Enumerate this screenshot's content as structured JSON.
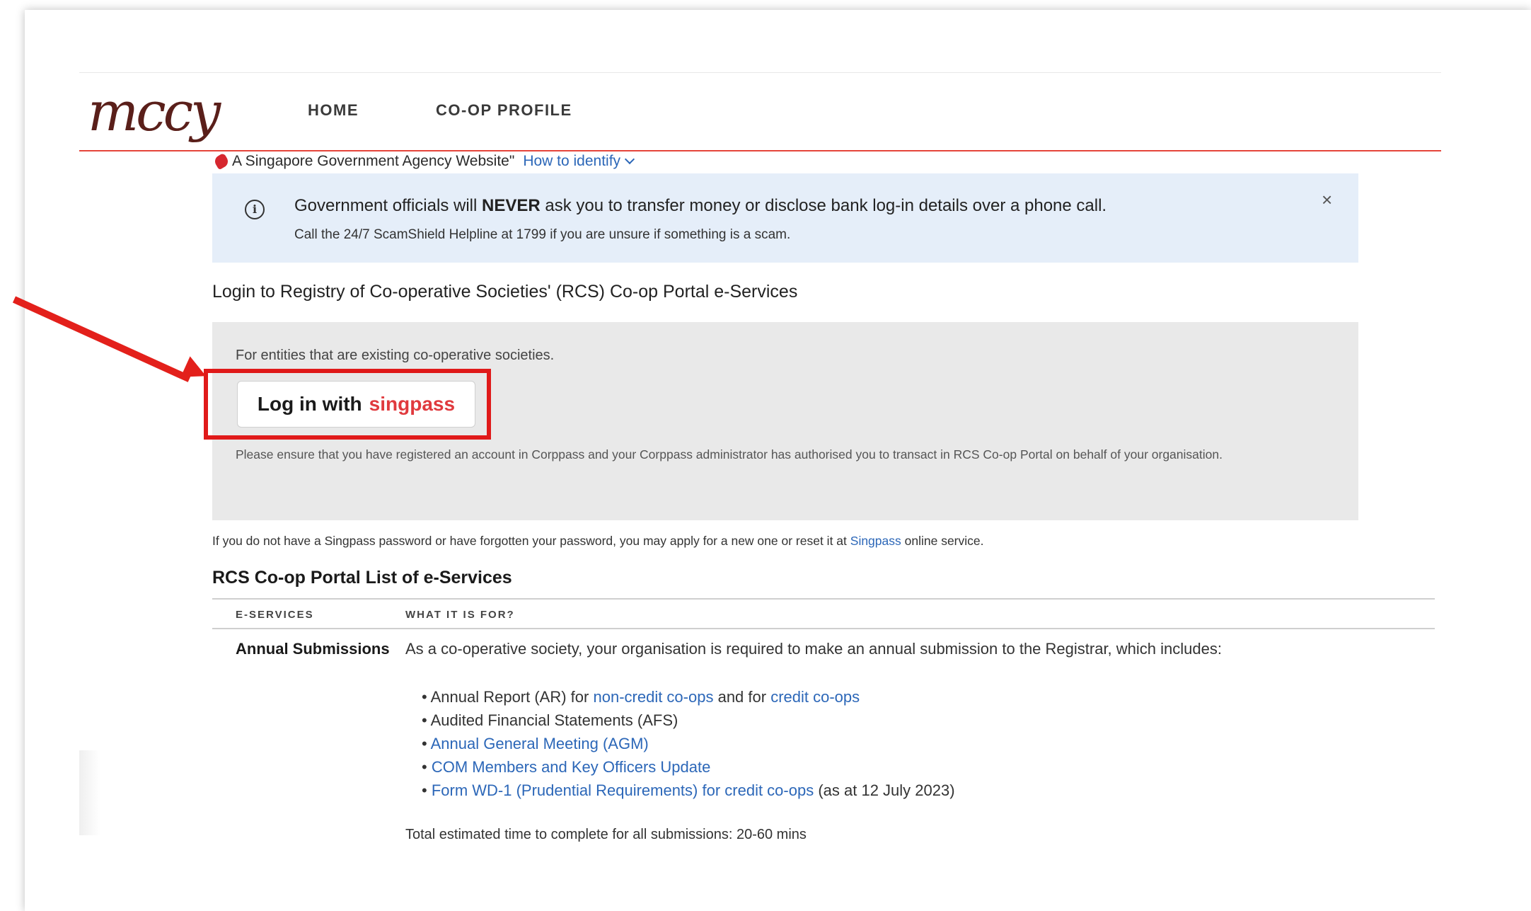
{
  "header": {
    "logo_text": "mccy",
    "nav": [
      "HOME",
      "CO-OP PROFILE"
    ]
  },
  "gov_banner": {
    "text": "A Singapore Government Agency Website\"",
    "identify_link": "How to identify"
  },
  "notice": {
    "line1_pre": "Government officials will ",
    "line1_bold": "NEVER",
    "line1_post": " ask you to transfer money or disclose bank log-in details over a phone call.",
    "line2": "Call the 24/7 ScamShield Helpline at 1799 if you are unsure if something is a scam.",
    "close": "×",
    "info_icon": "i"
  },
  "login": {
    "title": "Login to Registry of Co-operative Societies' (RCS) Co-op Portal e-Services",
    "entity_text": "For entities that are existing co-operative societies.",
    "button_prefix": "Log in with",
    "button_brand": "singpass",
    "ensure_text": "Please ensure that you have registered an account in Corppass and your Corppass administrator has authorised you to transact in RCS Co-op Portal on behalf of your organisation."
  },
  "forgot": {
    "pre": "If you do not have a Singpass password or have forgotten your password, you may apply for a new one or reset it at ",
    "link": "Singpass",
    "post": " online service."
  },
  "eservices": {
    "heading": "RCS Co-op Portal List of e-Services",
    "columns": [
      "E-SERVICES",
      "WHAT IT IS FOR?"
    ],
    "row": {
      "name": "Annual Submissions",
      "description": "As a co-operative society, your organisation is required to make an annual submission to the Registrar, which includes:",
      "ar_pre": "• Annual Report (AR) for ",
      "ar_link1": "non-credit co-ops",
      "ar_mid": " and for ",
      "ar_link2": "credit co-ops",
      "afs": "• Audited Financial Statements (AFS)",
      "bullet": "• ",
      "agm_link": "Annual General Meeting (AGM)",
      "com_link": "COM Members and Key Officers Update",
      "wd_link": "Form WD-1 (Prudential Requirements) for credit co-ops",
      "wd_post": " (as at 12 July 2023)",
      "total": "Total estimated time to complete for all submissions: 20-60 mins"
    }
  },
  "colors": {
    "accent_red": "#e5443a",
    "link_blue": "#2c67b8",
    "singpass_red": "#e03a3e",
    "annotation_red": "#e01a1a"
  }
}
